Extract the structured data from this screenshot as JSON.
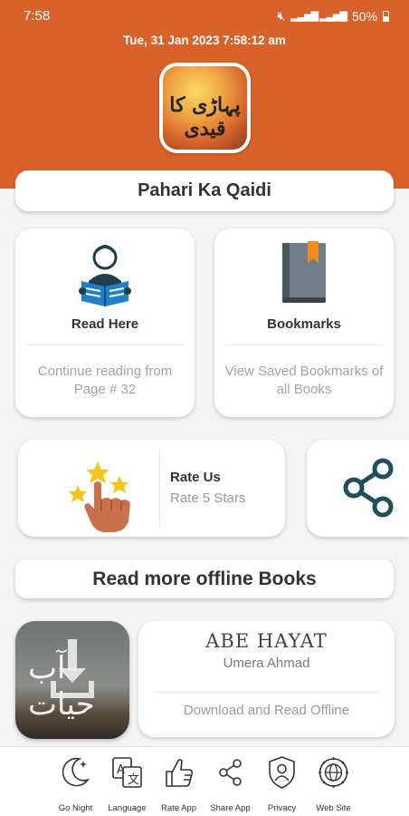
{
  "status": {
    "time": "7:58",
    "battery": "50%"
  },
  "header": {
    "datetime": "Tue, 31  Jan  2023   7:58:12 am",
    "logo_text": "پہاڑی کا قیدی"
  },
  "book_title": "Pahari Ka Qaidi",
  "tiles": {
    "read": {
      "label": "Read Here",
      "sub": "Continue reading from Page # 32"
    },
    "bookmarks": {
      "label": "Bookmarks",
      "sub": "View Saved Bookmarks of all Books"
    }
  },
  "rate": {
    "title": "Rate Us",
    "sub": "Rate 5 Stars"
  },
  "more_books": "Read more offline Books",
  "featured_book": {
    "title": "ABE HAYAT",
    "author": "Umera Ahmad",
    "action": "Download and Read Offline",
    "thumb_text": "آب حیات"
  },
  "bottom_nav": [
    {
      "label": "Go Night",
      "icon": "moon-icon"
    },
    {
      "label": "Language",
      "icon": "translate-icon"
    },
    {
      "label": "Rate App",
      "icon": "thumbs-up-icon"
    },
    {
      "label": "Share App",
      "icon": "share-icon"
    },
    {
      "label": "Privacy",
      "icon": "privacy-shield-icon"
    },
    {
      "label": "Web Site",
      "icon": "globe-icon"
    }
  ],
  "colors": {
    "header": "#d9622b",
    "accent_dark": "#1f4f5a",
    "book_blue": "#1f7fc9",
    "star": "#f5c518"
  }
}
